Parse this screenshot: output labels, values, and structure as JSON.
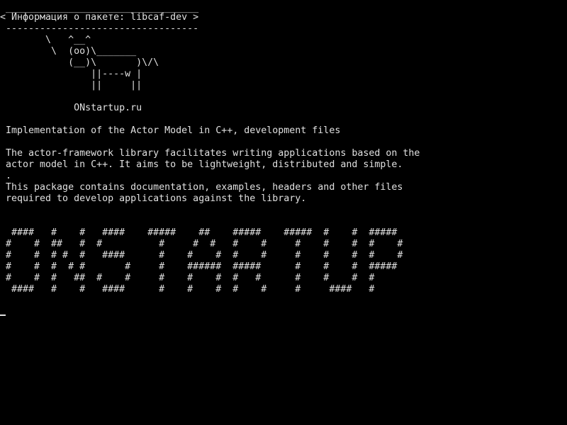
{
  "terminal": {
    "colors": {
      "background": "#000000",
      "foreground": "#e0e0e0"
    },
    "cowsay": {
      "border_top": " __________________________________",
      "message": "< Информация о пакете: libcaf-dev >",
      "border_bottom": " ----------------------------------",
      "cow": [
        "        \\   ^__^",
        "         \\  (oo)\\_______",
        "            (__)\\       )\\/\\",
        "                ||----w |",
        "                ||     ||"
      ],
      "site": "             ONstartup.ru"
    },
    "package_info": {
      "summary": " Implementation of the Actor Model in C++, development files",
      "description": [
        " The actor-framework library facilitates writing applications based on the",
        " actor model in C++. It aims to be lightweight, distributed and simple.",
        " .",
        " This package contains documentation, examples, headers and other files",
        " required to develop applications against the library."
      ]
    },
    "banner": [
      "  ####   #    #   ####    #####    ##    #####    #####  #    #  #####",
      " #    #  ##   #  #          #     #  #   #    #     #    #    #  #    #",
      " #    #  # #  #   ####      #    #    #  #    #     #    #    #  #    #",
      " #    #  #  # #       #     #    ######  #####      #    #    #  #####",
      " #    #  #   ##  #    #     #    #    #  #   #      #    #    #  #",
      "  ####   #    #   ####      #    #    #  #    #     #     ####   #"
    ]
  }
}
